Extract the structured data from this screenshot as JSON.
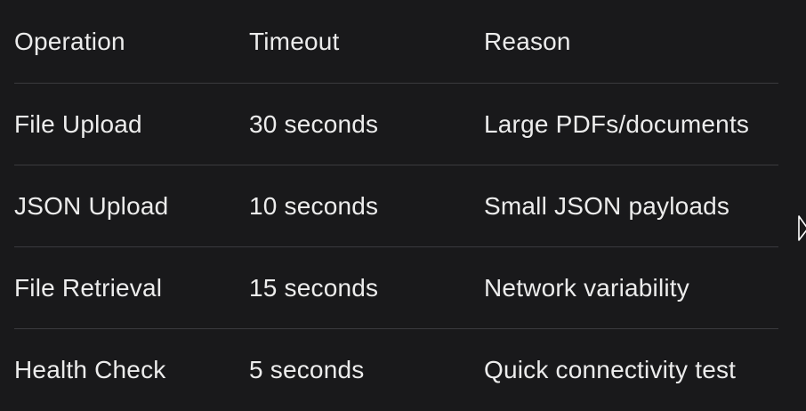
{
  "table": {
    "headers": [
      "Operation",
      "Timeout",
      "Reason"
    ],
    "rows": [
      [
        "File Upload",
        "30 seconds",
        "Large PDFs/documents"
      ],
      [
        "JSON Upload",
        "10 seconds",
        "Small JSON payloads"
      ],
      [
        "File Retrieval",
        "15 seconds",
        "Network variability"
      ],
      [
        "Health Check",
        "5 seconds",
        "Quick connectivity test"
      ]
    ]
  },
  "colors": {
    "background": "#19191b",
    "text": "#ececec",
    "divider": "#3a3a3e"
  }
}
